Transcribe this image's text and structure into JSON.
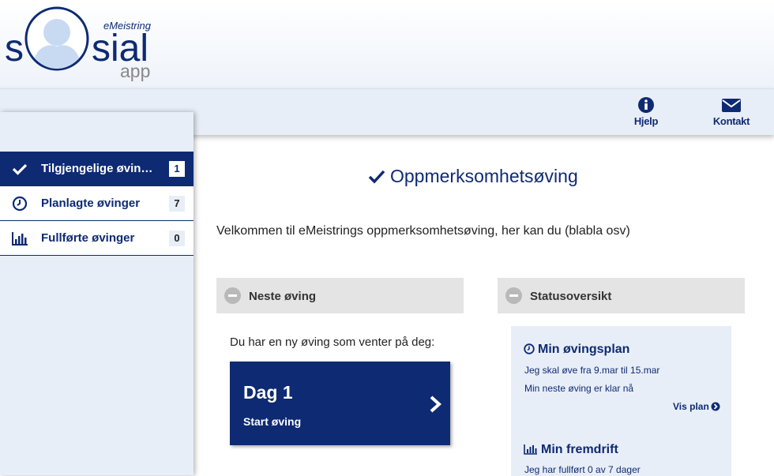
{
  "logo": {
    "small": "eMeistring",
    "left": "s",
    "right": "sial",
    "sub": "app"
  },
  "topbar": {
    "help_label": "Hjelp",
    "contact_label": "Kontakt"
  },
  "sidebar": {
    "items": [
      {
        "label": "Tilgjengelige øvinger",
        "count": "1",
        "icon": "check-icon",
        "active": true
      },
      {
        "label": "Planlagte øvinger",
        "count": "7",
        "icon": "clock-icon",
        "active": false
      },
      {
        "label": "Fullførte øvinger",
        "count": "0",
        "icon": "bar-chart-icon",
        "active": false
      }
    ]
  },
  "main": {
    "title": "Oppmerksomhetsøving",
    "welcome": "Velkommen til eMeistrings oppmerksomhetsøving, her kan du (blabla osv)",
    "next_panel": {
      "heading": "Neste øving",
      "text": "Du har en ny øving som venter på deg:",
      "card_title": "Dag 1",
      "card_action": "Start øving"
    },
    "status_panel": {
      "heading": "Statusoversikt",
      "plan_title": "Min øvingsplan",
      "plan_line1": "Jeg skal øve fra 9.mar til 15.mar",
      "plan_line2": "Min neste øving er klar nå",
      "plan_link": "Vis plan",
      "progress_title": "Min fremdrift",
      "progress_line1": "Jeg har fullført 0 av 7 dager"
    }
  },
  "colors": {
    "brand": "#0e2a73",
    "panel_head": "#e4e4e4",
    "light_blue": "#e8eef7"
  }
}
